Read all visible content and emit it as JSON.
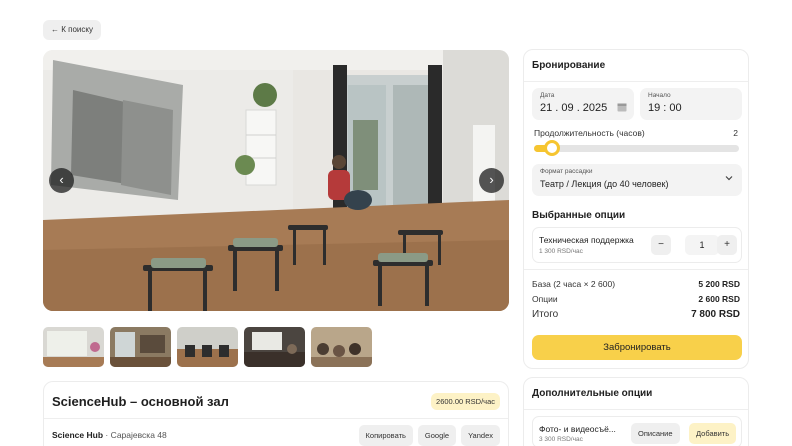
{
  "nav": {
    "back_label": "← К поиску"
  },
  "gallery": {
    "prev_icon": "‹",
    "next_icon": "›",
    "thumbnails": [
      "thumb-1",
      "thumb-2",
      "thumb-3",
      "thumb-4",
      "thumb-5"
    ]
  },
  "venue": {
    "title": "ScienceHub – основной зал",
    "price_badge": "2600.00 RSD/час",
    "org_name": "Science Hub",
    "address": " · Сарајевска 48",
    "actions": {
      "copy": "Копировать",
      "google": "Google",
      "yandex": "Yandex"
    }
  },
  "booking": {
    "title": "Бронирование",
    "date": {
      "label": "Дата",
      "value": "21 . 09 . 2025"
    },
    "start": {
      "label": "Начало",
      "value": "19 : 00"
    },
    "duration": {
      "label": "Продолжительность (часов)",
      "value": "2",
      "slider_fraction": 0.09
    },
    "seating": {
      "label": "Формат рассадки",
      "value": "Театр / Лекция (до 40 человек)"
    },
    "selected_options_title": "Выбранные опции",
    "option": {
      "name": "Техническая поддержка",
      "price": "1 300 RSD/час",
      "quantity": "1",
      "minus": "−",
      "plus": "+"
    },
    "summary": {
      "base_label": "База (2 часа × 2 600)",
      "base_value": "5 200 RSD",
      "options_label": "Опции",
      "options_value": "2 600 RSD",
      "total_label": "Итого",
      "total_value": "7 800 RSD"
    },
    "submit_label": "Забронировать"
  },
  "extras": {
    "title": "Дополнительные опции",
    "item": {
      "name": "Фото- и видеосъё...",
      "price": "3 300 RSD/час",
      "desc_label": "Описание",
      "add_label": "Добавить"
    }
  },
  "colors": {
    "accent": "#f8d04a",
    "badge": "#fdf2c6"
  }
}
